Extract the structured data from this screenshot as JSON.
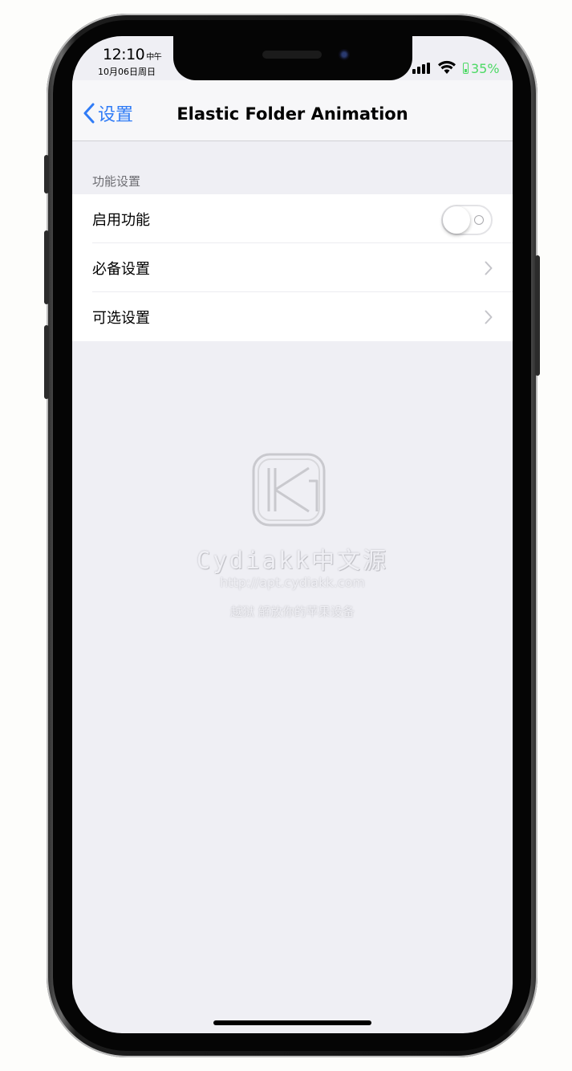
{
  "status_bar": {
    "time": "12:10",
    "period": "中午",
    "date": "10月06日周日",
    "battery": "35%",
    "battery_color": "#4cd964"
  },
  "nav": {
    "back_label": "设置",
    "title": "Elastic Folder Animation",
    "accent_color": "#2f7bf6"
  },
  "section": {
    "header": "功能设置",
    "rows": [
      {
        "label": "启用功能",
        "control": "toggle",
        "toggle_on": false
      },
      {
        "label": "必备设置",
        "control": "chevron-right-icon"
      },
      {
        "label": "可选设置",
        "control": "chevron-right-icon"
      }
    ]
  },
  "watermark": {
    "title": "Cydiakk中文源",
    "url": "http://apt.cydiakk.com",
    "slogan": "越狱 解放你的苹果设备"
  }
}
